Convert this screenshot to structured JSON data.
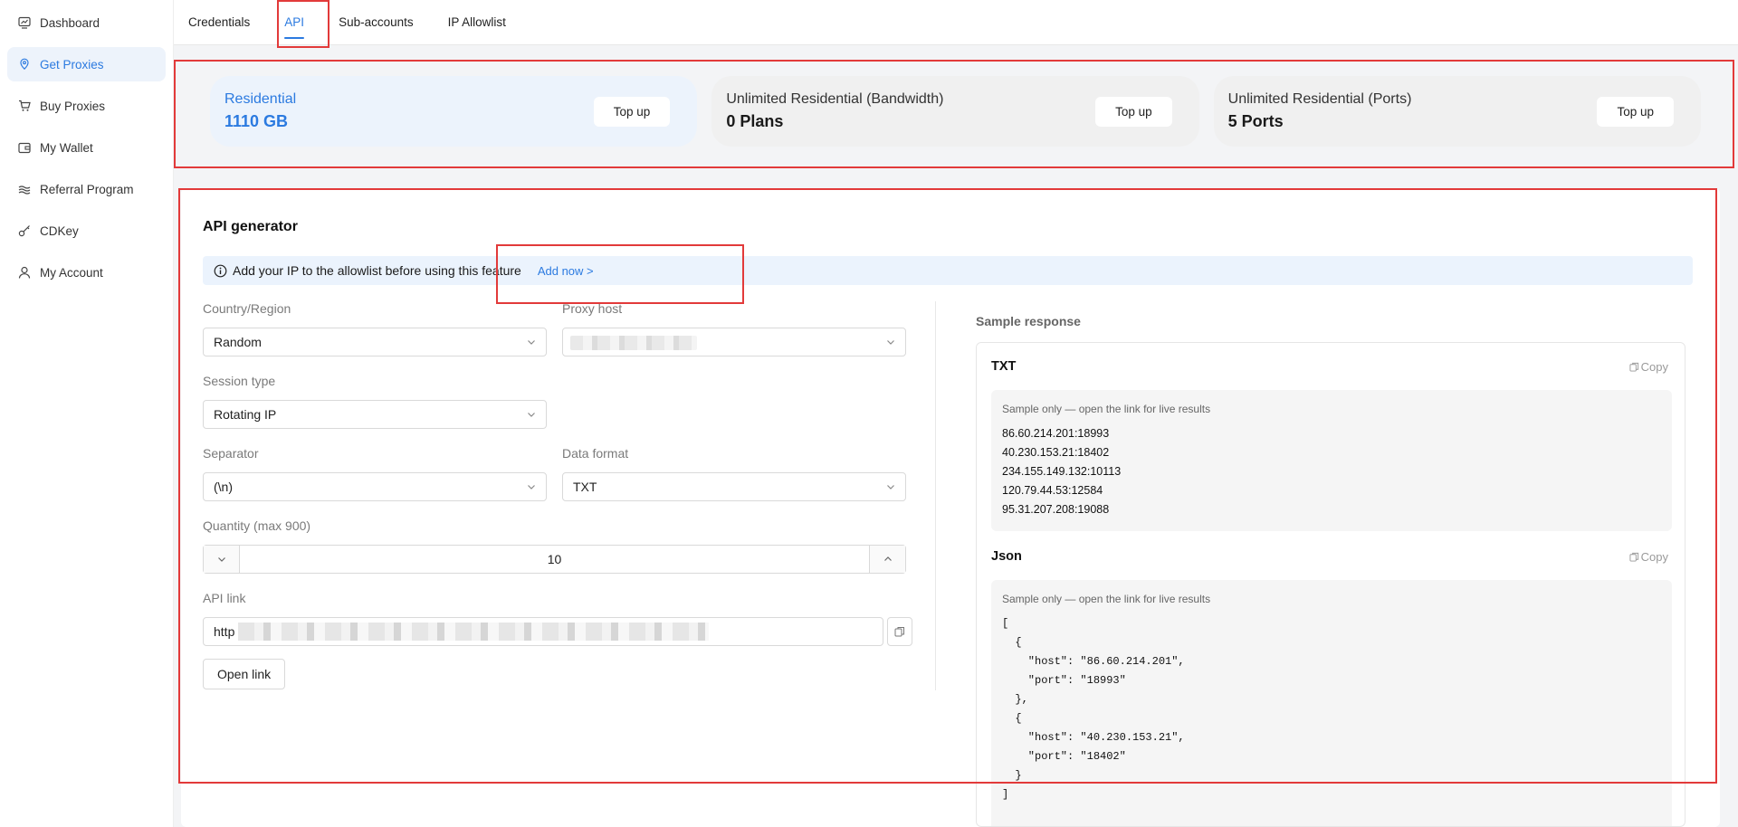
{
  "sidebar": {
    "items": [
      {
        "label": "Dashboard",
        "icon": "dashboard-icon"
      },
      {
        "label": "Get Proxies",
        "icon": "location-pin-icon",
        "active": true
      },
      {
        "label": "Buy Proxies",
        "icon": "cart-icon"
      },
      {
        "label": "My Wallet",
        "icon": "wallet-icon"
      },
      {
        "label": "Referral Program",
        "icon": "layers-icon"
      },
      {
        "label": "CDKey",
        "icon": "key-icon"
      },
      {
        "label": "My Account",
        "icon": "user-icon"
      }
    ]
  },
  "tabs": [
    {
      "label": "Credentials"
    },
    {
      "label": "API",
      "active": true
    },
    {
      "label": "Sub-accounts"
    },
    {
      "label": "IP Allowlist"
    }
  ],
  "plans": [
    {
      "title": "Residential",
      "value": "1110 GB",
      "button": "Top up",
      "active": true
    },
    {
      "title": "Unlimited Residential (Bandwidth)",
      "value": "0 Plans",
      "button": "Top up"
    },
    {
      "title": "Unlimited Residential (Ports)",
      "value": "5 Ports",
      "button": "Top up"
    }
  ],
  "generator": {
    "title": "API generator",
    "notice": "Add your IP to the allowlist before using this feature",
    "notice_link": "Add now >",
    "country_label": "Country/Region",
    "country_value": "Random",
    "proxy_host_label": "Proxy host",
    "session_label": "Session type",
    "session_value": "Rotating IP",
    "separator_label": "Separator",
    "separator_value": "(\\n)",
    "format_label": "Data format",
    "format_value": "TXT",
    "quantity_label": "Quantity (max 900)",
    "quantity_value": "10",
    "api_link_label": "API link",
    "api_link_prefix": "http",
    "open_link": "Open link"
  },
  "sample": {
    "title": "Sample response",
    "copy_label": "Copy",
    "txt": {
      "heading": "TXT",
      "note": "Sample only — open the link for live results",
      "lines": [
        "86.60.214.201:18993",
        "40.230.153.21:18402",
        "234.155.149.132:10113",
        "120.79.44.53:12584",
        "95.31.207.208:19088"
      ]
    },
    "json": {
      "heading": "Json",
      "note": "Sample only — open the link for live results",
      "lines": [
        "[",
        "  {",
        "    \"host\": \"86.60.214.201\",",
        "    \"port\": \"18993\"",
        "  },",
        "  {",
        "    \"host\": \"40.230.153.21\",",
        "    \"port\": \"18402\"",
        "  }",
        "]"
      ]
    }
  },
  "colors": {
    "accent": "#2b7ae0",
    "highlight": "#e23a3a"
  }
}
